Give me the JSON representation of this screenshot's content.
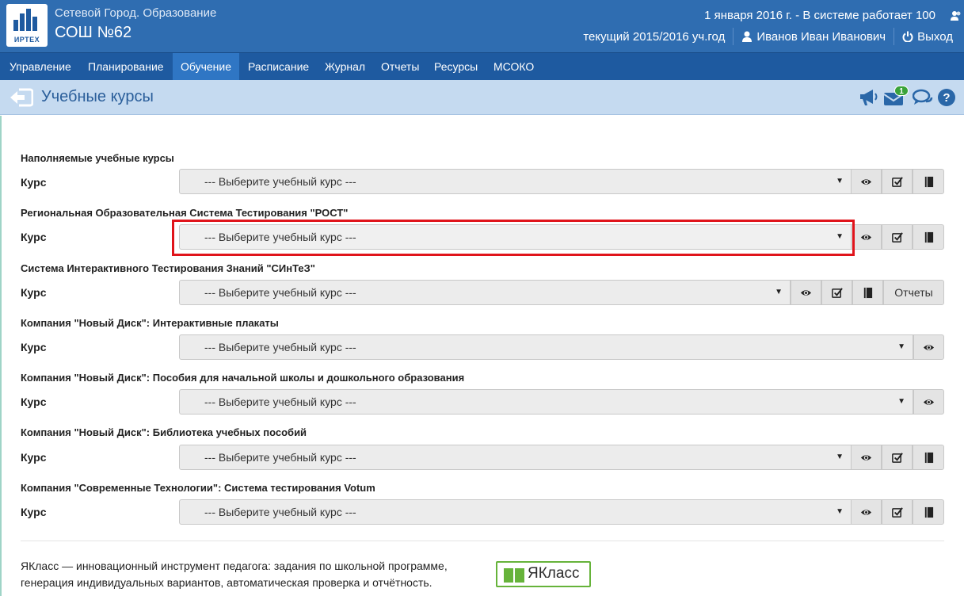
{
  "header": {
    "app_name": "Сетевой Город. Образование",
    "school_name": "СОШ №62",
    "logo_text": "ИРТЕХ",
    "status_line": "1 января 2016 г. - В системе работает 100",
    "academic_year": "текущий 2015/2016 уч.год",
    "user_name": "Иванов Иван Иванович",
    "logout_label": "Выход"
  },
  "nav": {
    "items": [
      "Управление",
      "Планирование",
      "Обучение",
      "Расписание",
      "Журнал",
      "Отчеты",
      "Ресурсы",
      "МСОКО"
    ],
    "active": "Обучение"
  },
  "page": {
    "title": "Учебные курсы",
    "mail_badge": "1"
  },
  "sections": [
    {
      "title": "Наполняемые учебные курсы",
      "label": "Курс",
      "placeholder": "--- Выберите учебный курс ---"
    },
    {
      "title": "Региональная Образовательная Система Тестирования \"РОСТ\"",
      "label": "Курс",
      "placeholder": "--- Выберите учебный курс ---"
    },
    {
      "title": "Система Интерактивного Тестирования Знаний \"СИнТеЗ\"",
      "label": "Курс",
      "placeholder": "--- Выберите учебный курс ---",
      "extra_button": "Отчеты"
    },
    {
      "title": "Компания \"Новый Диск\": Интерактивные плакаты",
      "label": "Курс",
      "placeholder": "--- Выберите учебный курс ---"
    },
    {
      "title": "Компания \"Новый Диск\": Пособия для начальной школы и дошкольного образования",
      "label": "Курс",
      "placeholder": "--- Выберите учебный курс ---"
    },
    {
      "title": "Компания \"Новый Диск\": Библиотека учебных пособий",
      "label": "Курс",
      "placeholder": "--- Выберите учебный курс ---"
    },
    {
      "title": "Компания \"Современные Технологии\": Система тестирования Votum",
      "label": "Курс",
      "placeholder": "--- Выберите учебный курс ---"
    }
  ],
  "footer": {
    "text": "ЯКласс — инновационный инструмент педагога: задания по школьной программе, генерация индивидуальных вариантов, автоматическая проверка и отчётность.",
    "yaklass_label": "ЯКласс"
  },
  "colors": {
    "header_bg": "#2f6db1",
    "nav_bg": "#1e5aa0",
    "titlebar_bg": "#c5daf0",
    "highlight": "#e0141b",
    "yaklass_green": "#66b33a"
  },
  "icons": {
    "back": "back-arrow-icon",
    "announce": "megaphone-icon",
    "mail": "envelope-icon",
    "chat": "chat-bubbles-icon",
    "help": "question-circle-icon",
    "view": "eye-icon",
    "check": "checkbox-check-icon",
    "book": "book-icon",
    "user": "user-icon",
    "power": "power-icon",
    "users": "users-icon"
  }
}
